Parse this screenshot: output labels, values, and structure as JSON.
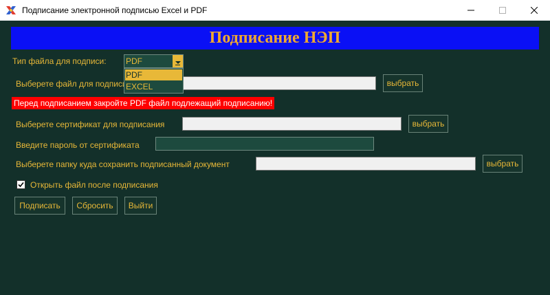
{
  "window": {
    "title": "Подписание электронной подписью Excel и PDF",
    "icons": {
      "app": "app-icon",
      "minimize": "minimize-icon",
      "maximize": "maximize-icon",
      "close": "close-icon"
    }
  },
  "banner": {
    "text": "Подписание НЭП"
  },
  "file_type": {
    "label": "Тип файла для подписи:",
    "selected": "PDF",
    "options": [
      "PDF",
      "EXCEL"
    ]
  },
  "file_select": {
    "label": "Выберете файл для подписи",
    "value": "",
    "button": "выбрать"
  },
  "warning": "Перед подписанием закройте PDF файл подлежащий подписанию!",
  "certificate": {
    "label": "Выберете сертификат для подписания",
    "value": "",
    "button": "выбрать"
  },
  "password": {
    "label": "Введите пароль от сертификата",
    "value": ""
  },
  "output_folder": {
    "label": "Выберете папку куда сохранить подписанный документ",
    "value": "",
    "button": "выбрать"
  },
  "open_after": {
    "label": "Открыть файл после подписания",
    "checked": true
  },
  "actions": {
    "sign": "Подписать",
    "reset": "Сбросить",
    "exit": "Выйти"
  },
  "colors": {
    "background": "#13302a",
    "accent": "#e8b838",
    "banner": "#0a10f5",
    "banner_text": "#f0a830",
    "warning": "#ff0000"
  }
}
